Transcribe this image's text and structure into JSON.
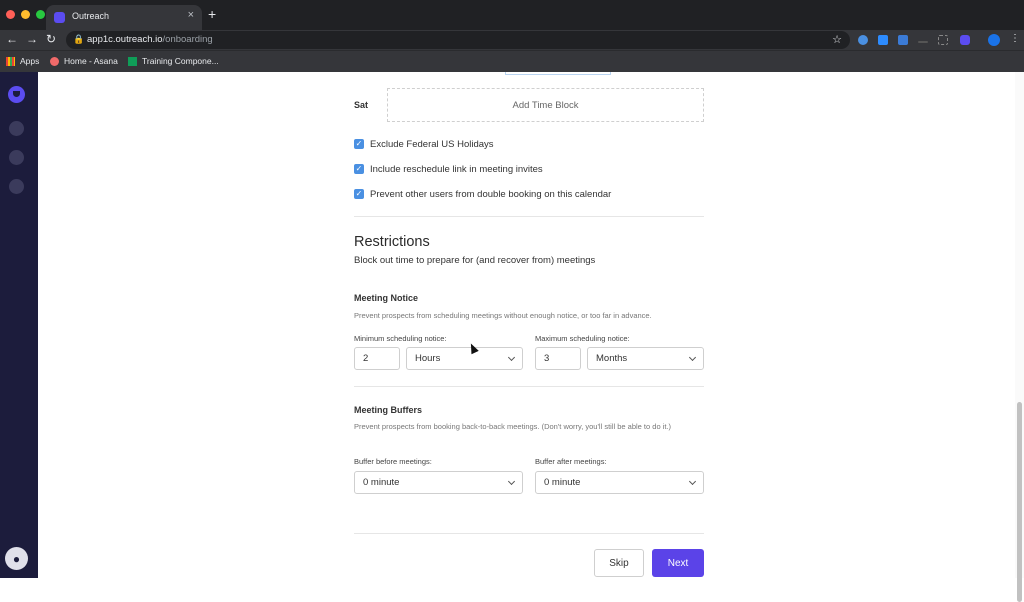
{
  "browser": {
    "tab_title": "Outreach",
    "tab_close": "×",
    "new_tab": "+",
    "url_host": "app1c.outreach.io",
    "url_path": "/onboarding",
    "bookmarks": [
      {
        "label": "Apps"
      },
      {
        "label": "Home - Asana"
      },
      {
        "label": "Training Compone..."
      }
    ],
    "colors": {
      "dot_red": "#ff5f57",
      "dot_yellow": "#febc2e",
      "dot_green": "#28c840",
      "brand": "#5b4cf0"
    }
  },
  "schedule": {
    "day": "Sat",
    "add_time_block": "Add Time Block"
  },
  "options": [
    {
      "label": "Exclude Federal US Holidays",
      "checked": true
    },
    {
      "label": "Include reschedule link in meeting invites",
      "checked": true
    },
    {
      "label": "Prevent other users from double booking on this calendar",
      "checked": true
    }
  ],
  "restrictions": {
    "title": "Restrictions",
    "subtitle": "Block out time to prepare for (and recover from) meetings"
  },
  "meeting_notice": {
    "title": "Meeting Notice",
    "description": "Prevent prospects from scheduling meetings without enough notice, or too far in advance.",
    "min_label": "Minimum scheduling notice:",
    "min_value": "2",
    "min_unit": "Hours",
    "max_label": "Maximum scheduling notice:",
    "max_value": "3",
    "max_unit": "Months"
  },
  "meeting_buffers": {
    "title": "Meeting Buffers",
    "description": "Prevent prospects from booking back-to-back meetings. (Don't worry, you'll still be able to do it.)",
    "before_label": "Buffer before meetings:",
    "before_value": "0 minute",
    "after_label": "Buffer after meetings:",
    "after_value": "0 minute"
  },
  "actions": {
    "skip": "Skip",
    "next": "Next"
  }
}
